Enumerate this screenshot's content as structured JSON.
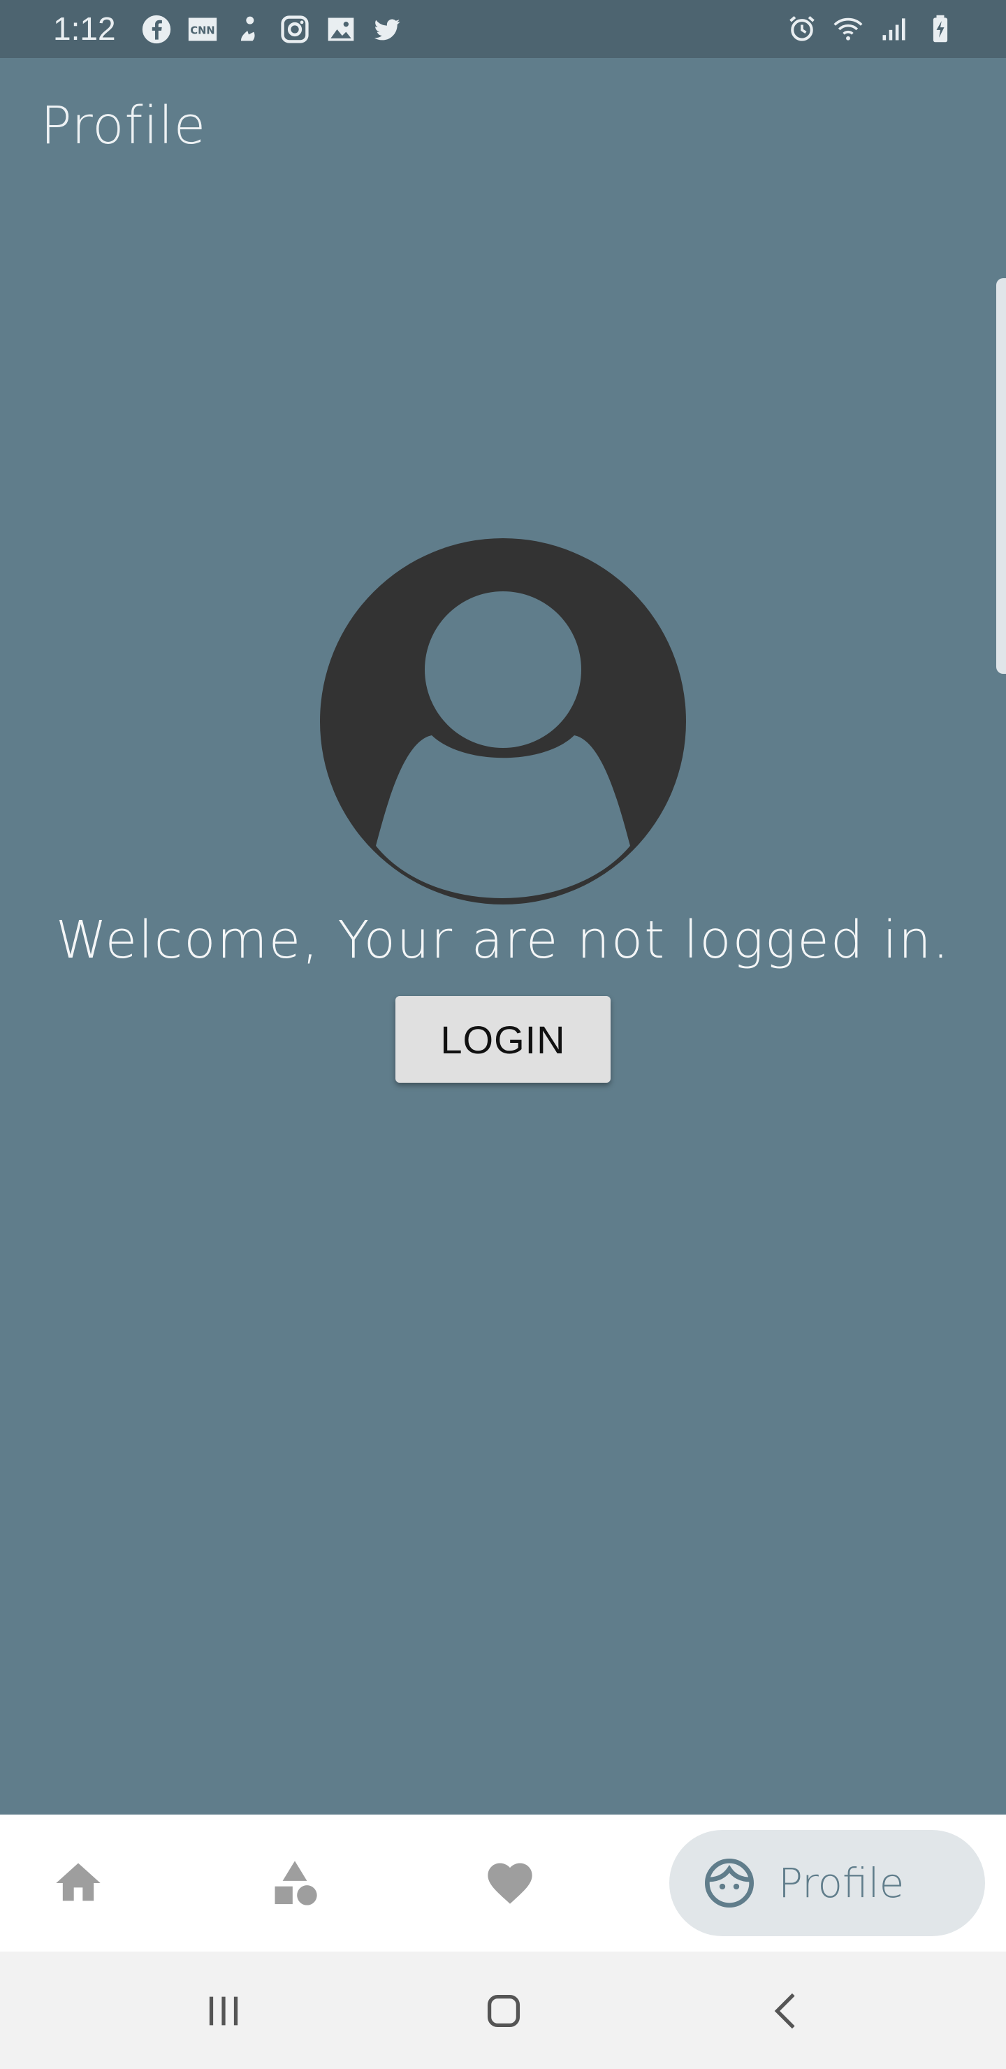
{
  "status_bar": {
    "time": "1:12",
    "left_icons": [
      "facebook-icon",
      "cnn-icon",
      "app-icon",
      "instagram-icon",
      "gallery-icon",
      "twitter-icon"
    ],
    "right_icons": [
      "alarm-icon",
      "wifi-icon",
      "signal-icon",
      "battery-charging-icon"
    ]
  },
  "header": {
    "title": "Profile"
  },
  "main": {
    "welcome_text": "Welcome, Your are not logged in.",
    "login_label": "LOGIN"
  },
  "bottom_nav": {
    "items": [
      "home-icon",
      "shapes-icon",
      "heart-icon",
      "profile-icon"
    ],
    "active_label": "Profile"
  },
  "colors": {
    "background": "#607d8b",
    "status_bar": "#4d6470",
    "avatar": "#333333",
    "nav_active_pill": "#e1e6e9",
    "nav_inactive_icon": "#9e9e9e"
  }
}
